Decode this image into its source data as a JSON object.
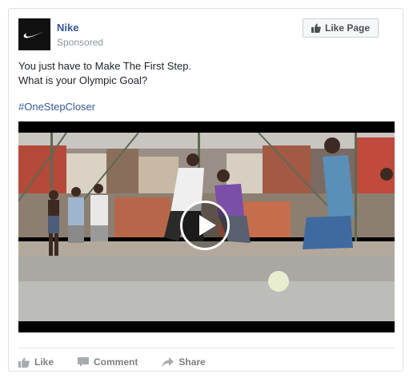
{
  "post": {
    "page_name": "Nike",
    "sponsored_label": "Sponsored",
    "like_page_label": "Like Page",
    "text_lines": [
      "You just have to Make The First Step.",
      "What is your Olympic Goal?"
    ],
    "hashtag": "#OneStepCloser"
  },
  "icons": {
    "avatar": "nike-swoosh-logo",
    "like_page": "thumbs-up-icon",
    "play": "play-icon",
    "like": "thumbs-up-icon",
    "comment": "comment-bubble-icon",
    "share": "share-arrow-icon"
  },
  "actions": {
    "like_label": "Like",
    "comment_label": "Comment",
    "share_label": "Share"
  },
  "colors": {
    "link": "#365899",
    "secondary_text": "#90949c",
    "action_text": "#7f7f7f",
    "border": "#dddfe2"
  }
}
